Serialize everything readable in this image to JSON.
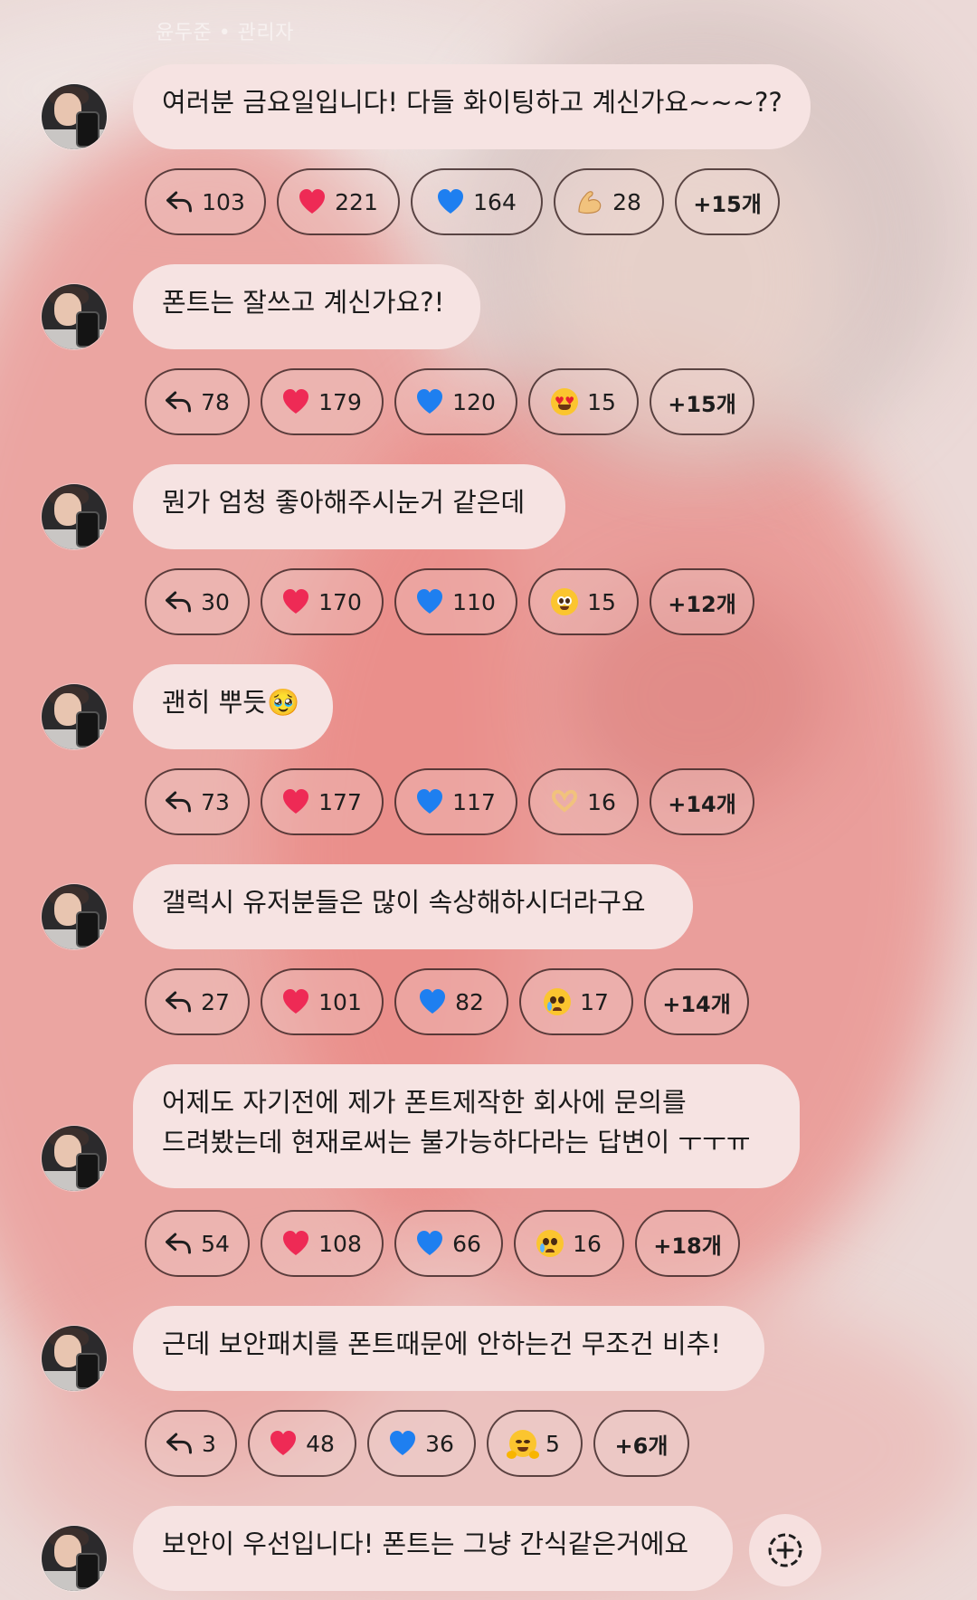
{
  "header": {
    "sender": "윤두준 • 관리자"
  },
  "messages": [
    {
      "text_lines": [
        "여러분 금요일입니다! 다들 화이팅하고 계신가요~~~??"
      ],
      "reactions": [
        {
          "icon": "reply-icon",
          "count": "103"
        },
        {
          "icon": "red-heart-icon",
          "count": "221"
        },
        {
          "icon": "blue-heart-icon",
          "count": "164"
        },
        {
          "icon": "flexed-biceps-icon",
          "count": "28"
        }
      ],
      "more": "+15개"
    },
    {
      "text_lines": [
        "폰트는 잘쓰고 계신가요?!"
      ],
      "reactions": [
        {
          "icon": "reply-icon",
          "count": "78"
        },
        {
          "icon": "red-heart-icon",
          "count": "179"
        },
        {
          "icon": "blue-heart-icon",
          "count": "120"
        },
        {
          "icon": "heart-eyes-icon",
          "count": "15"
        }
      ],
      "more": "+15개"
    },
    {
      "text_lines": [
        "뭔가 엄청 좋아해주시눈거 같은데"
      ],
      "reactions": [
        {
          "icon": "reply-icon",
          "count": "30"
        },
        {
          "icon": "red-heart-icon",
          "count": "170"
        },
        {
          "icon": "blue-heart-icon",
          "count": "110"
        },
        {
          "icon": "pleading-face-icon",
          "count": "15"
        }
      ],
      "more": "+12개"
    },
    {
      "text_lines": [
        "괜히 뿌듯🥹"
      ],
      "reactions": [
        {
          "icon": "reply-icon",
          "count": "73"
        },
        {
          "icon": "red-heart-icon",
          "count": "177"
        },
        {
          "icon": "blue-heart-icon",
          "count": "117"
        },
        {
          "icon": "heart-hands-icon",
          "count": "16"
        }
      ],
      "more": "+14개"
    },
    {
      "text_lines": [
        "갤럭시 유저분들은 많이 속상해하시더라구요"
      ],
      "reactions": [
        {
          "icon": "reply-icon",
          "count": "27"
        },
        {
          "icon": "red-heart-icon",
          "count": "101"
        },
        {
          "icon": "blue-heart-icon",
          "count": "82"
        },
        {
          "icon": "crying-face-icon",
          "count": "17"
        }
      ],
      "more": "+14개"
    },
    {
      "text_lines": [
        "어제도 자기전에 제가 폰트제작한 회사에 문의를",
        "드려봤는데 현재로써는 불가능하다라는 답변이 ㅜㅜㅠ"
      ],
      "reactions": [
        {
          "icon": "reply-icon",
          "count": "54"
        },
        {
          "icon": "red-heart-icon",
          "count": "108"
        },
        {
          "icon": "blue-heart-icon",
          "count": "66"
        },
        {
          "icon": "crying-face-icon",
          "count": "16"
        }
      ],
      "more": "+18개"
    },
    {
      "text_lines": [
        "근데 보안패치를 폰트때문에 안하는건 무조건 비추!"
      ],
      "reactions": [
        {
          "icon": "reply-icon",
          "count": "3"
        },
        {
          "icon": "red-heart-icon",
          "count": "48"
        },
        {
          "icon": "blue-heart-icon",
          "count": "36"
        },
        {
          "icon": "hugging-face-icon",
          "count": "5"
        }
      ],
      "more": "+6개"
    },
    {
      "text_lines": [
        "보안이 우선입니다! 폰트는 그냥 간식같은거에요"
      ],
      "reactions": [],
      "more": ""
    }
  ],
  "colors": {
    "bubble": "#f6e3e2",
    "red_heart": "#ee2a55",
    "blue_heart": "#1e7ff0"
  }
}
